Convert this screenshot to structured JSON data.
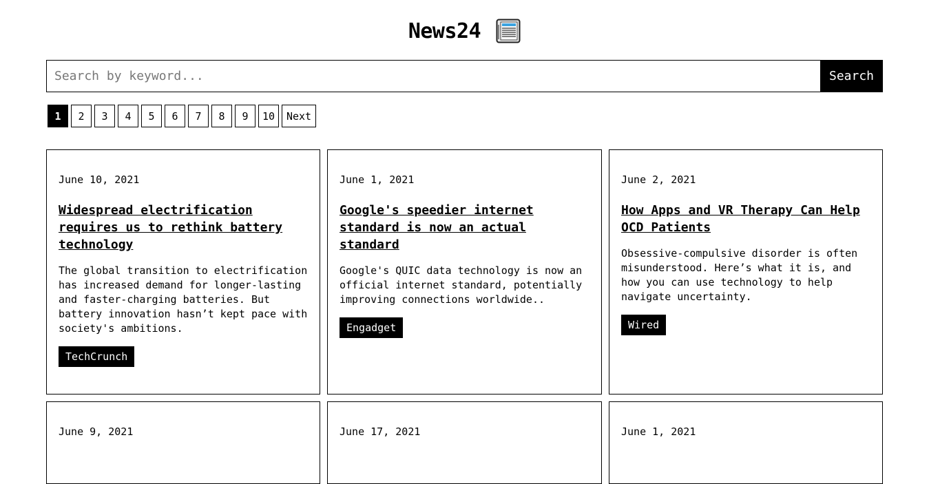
{
  "header": {
    "title": "News24",
    "icon": "newspaper-icon"
  },
  "search": {
    "placeholder": "Search by keyword...",
    "value": "",
    "button_label": "Search"
  },
  "pagination": {
    "pages": [
      "1",
      "2",
      "3",
      "4",
      "5",
      "6",
      "7",
      "8",
      "9",
      "10"
    ],
    "active_page": "1",
    "next_label": "Next"
  },
  "articles": [
    {
      "date": "June 10, 2021",
      "title": "Widespread electrification requires us to rethink battery technology",
      "description": "The global transition to electrification has increased demand for longer-lasting and faster-charging batteries. But battery innovation hasn’t kept pace with society's ambitions.",
      "source": "TechCrunch"
    },
    {
      "date": "June 1, 2021",
      "title": "Google's speedier internet standard is now an actual standard",
      "description": "Google's QUIC data technology is now an official internet standard, potentially improving connections worldwide..",
      "source": "Engadget"
    },
    {
      "date": "June 2, 2021",
      "title": "How Apps and VR Therapy Can Help OCD Patients",
      "description": "Obsessive-compulsive disorder is often misunderstood. Here’s what it is, and how you can use technology to help navigate uncertainty.",
      "source": "Wired"
    },
    {
      "date": "June 9, 2021"
    },
    {
      "date": "June 17, 2021"
    },
    {
      "date": "June 1, 2021"
    }
  ]
}
